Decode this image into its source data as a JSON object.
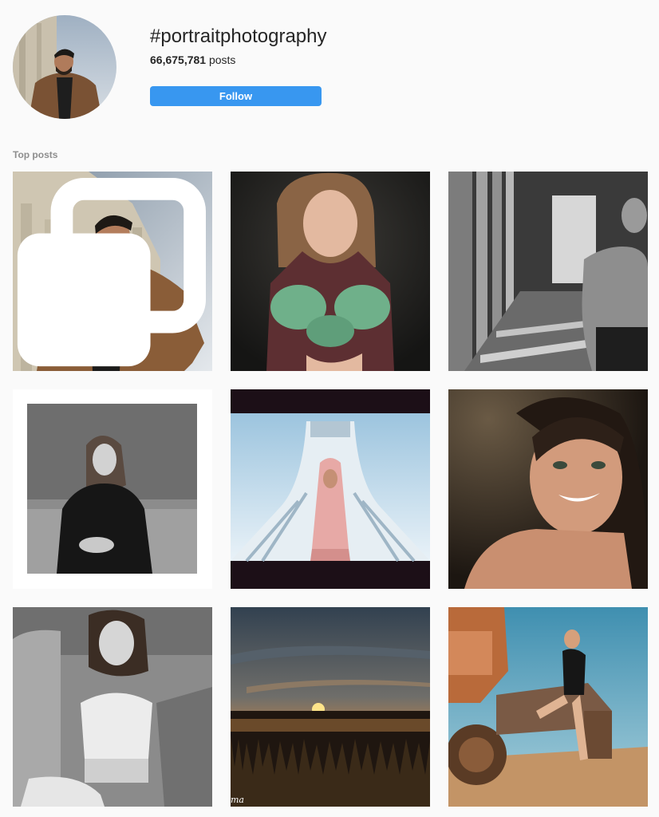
{
  "header": {
    "hashtag": "#portraitphotography",
    "post_count": "66,675,781",
    "post_count_suffix": " posts",
    "follow_label": "Follow"
  },
  "section": {
    "label": "Top posts"
  },
  "posts": [
    {
      "subject": "man in brown jacket",
      "multi": true
    },
    {
      "subject": "girl with green flowers"
    },
    {
      "subject": "shirtless man in corridor"
    },
    {
      "subject": "woman in black sweater bw"
    },
    {
      "subject": "woman in front of tower"
    },
    {
      "subject": "smiling woman"
    },
    {
      "subject": "woman in lace top bw"
    },
    {
      "subject": "sunset over lake",
      "watermark": "ma"
    },
    {
      "subject": "woman on machine"
    }
  ],
  "colors": {
    "accent": "#3897f0",
    "muted": "#8e8e8e",
    "background": "#fafafa"
  }
}
